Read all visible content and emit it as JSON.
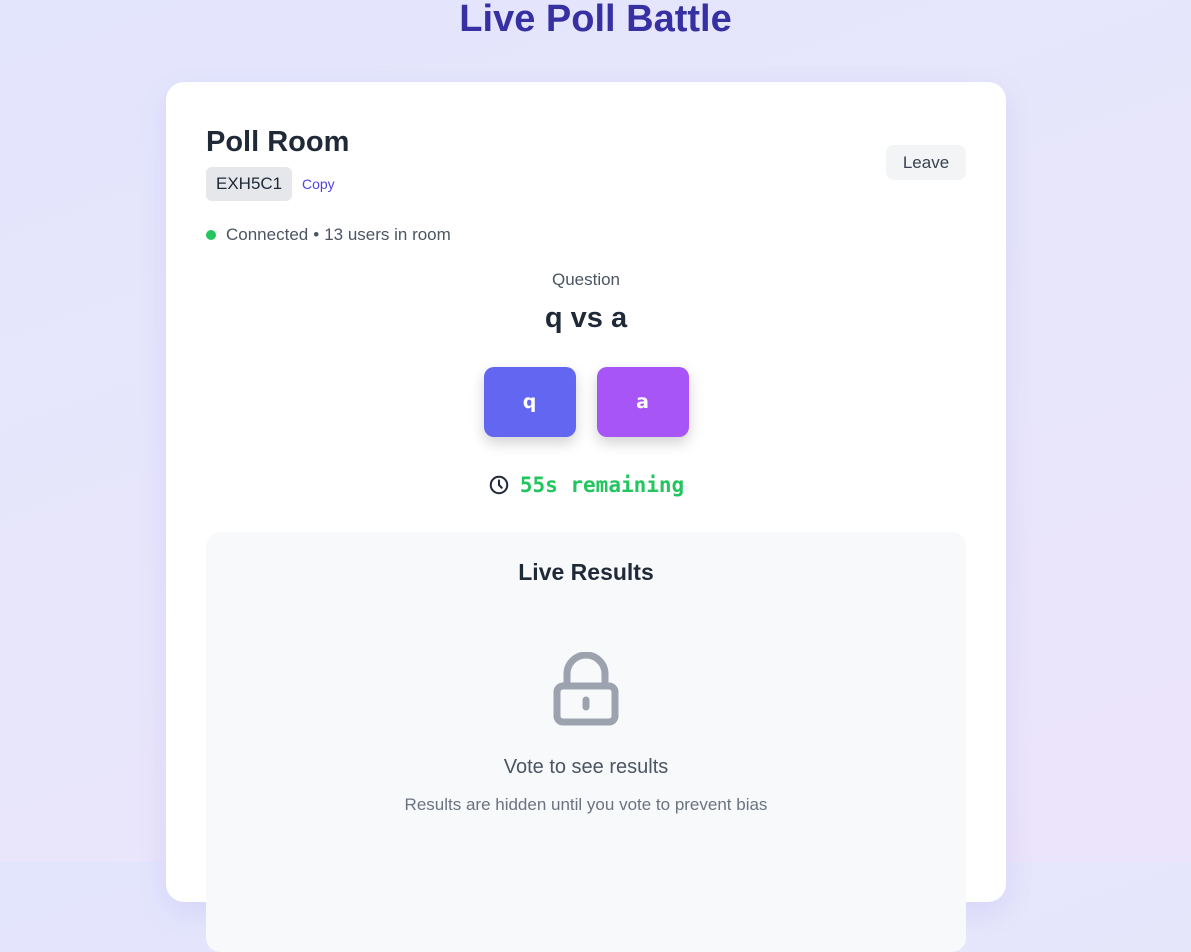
{
  "app": {
    "title": "Live Poll Battle"
  },
  "room": {
    "title": "Poll Room",
    "code": "EXH5C1",
    "copy_label": "Copy",
    "leave_label": "Leave"
  },
  "status": {
    "connection": "Connected",
    "separator": "•",
    "users": "13 users in room",
    "color": "#22c55e"
  },
  "poll": {
    "question_label": "Question",
    "question": "q vs a",
    "options": [
      {
        "label": "q",
        "color": "#6366f1"
      },
      {
        "label": "a",
        "color": "#a855f7"
      }
    ],
    "timer_icon": "clock-icon",
    "timer_text": "55s remaining"
  },
  "results": {
    "title": "Live Results",
    "icon": "lock-icon",
    "prompt": "Vote to see results",
    "subtext": "Results are hidden until you vote to prevent bias"
  }
}
